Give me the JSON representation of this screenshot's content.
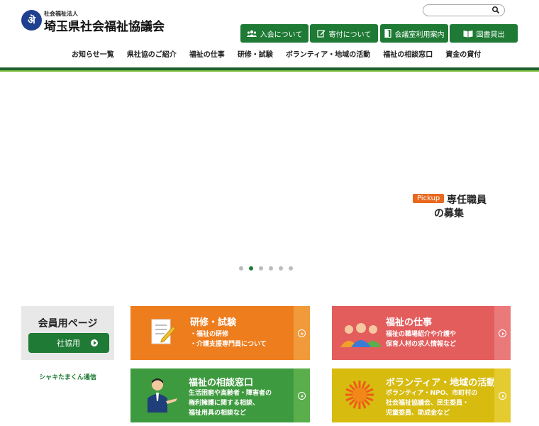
{
  "header": {
    "logo_mark": "ऄ",
    "org_small": "社会福祉法人",
    "org_name": "埼玉県社会福祉協議会",
    "search_placeholder": "",
    "buttons": [
      {
        "label": "入会について"
      },
      {
        "label": "寄付について"
      },
      {
        "label": "会議室利用案内"
      },
      {
        "label": "図書貸出"
      }
    ]
  },
  "nav": [
    "お知らせ一覧",
    "県社協のご紹介",
    "福祉の仕事",
    "研修・試験",
    "ボランティア・地域の活動",
    "福祉の相談窓口",
    "資金の貸付"
  ],
  "slider": {
    "pickup_badge": "Pickup",
    "pickup_line1": "専任職員",
    "pickup_line2": "の募集",
    "dot_count": 6,
    "active_dot": 1
  },
  "member": {
    "title": "会員用ページ",
    "button": "社協用",
    "link": "シャキたまくん通信"
  },
  "cards": [
    {
      "title": "研修・試験",
      "desc": [
        "・福祉の研修",
        "・介護支援専門員について"
      ],
      "color": "#ee7d1e",
      "side": "#f09a3a"
    },
    {
      "title": "福祉の仕事",
      "desc": [
        "福祉の職場紹介や介護や",
        "保育人材の求人情報など"
      ],
      "color": "#e35d5d",
      "side": "#ea7a7a"
    },
    {
      "title": "福祉の相談窓口",
      "desc": [
        "生活困窮や高齢者・障害者の",
        "権利擁護に関する相談、",
        "福祉用具の相談など"
      ],
      "color": "#3e9a3e",
      "side": "#5aae4c"
    },
    {
      "title": "ボランティア・地域の活動",
      "desc": [
        "ボランティア・NPO、市町村の",
        "社会福祉協議会、民生委員・",
        "児童委員、助成金など"
      ],
      "color": "#d7bb0f",
      "side": "#e4cb30"
    }
  ]
}
